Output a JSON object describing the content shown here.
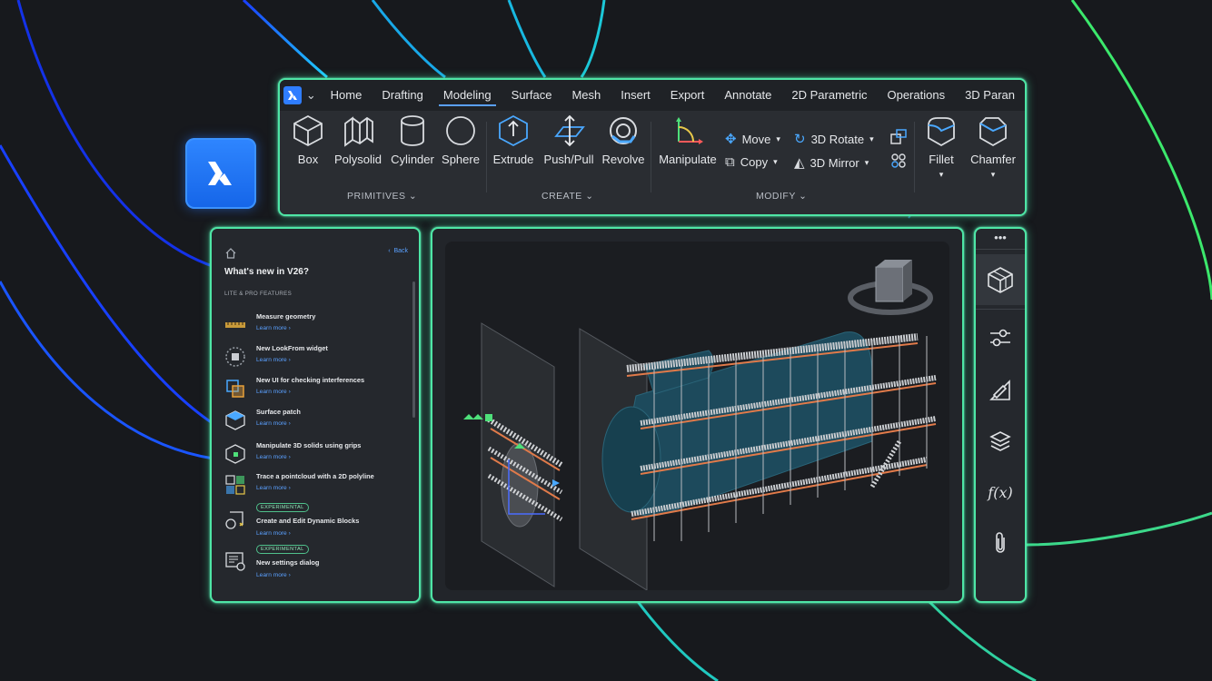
{
  "ribbon": {
    "tabs": [
      "Home",
      "Drafting",
      "Modeling",
      "Surface",
      "Mesh",
      "Insert",
      "Export",
      "Annotate",
      "2D Parametric",
      "Operations",
      "3D Paran"
    ],
    "active_tab": "Modeling",
    "primitives": {
      "group": "PRIMITIVES",
      "box": "Box",
      "polysolid": "Polysolid",
      "cylinder": "Cylinder",
      "sphere": "Sphere"
    },
    "create": {
      "group": "CREATE",
      "extrude": "Extrude",
      "pushpull": "Push/Pull",
      "revolve": "Revolve"
    },
    "modify": {
      "group": "MODIFY",
      "manipulate": "Manipulate",
      "move": "Move",
      "copy": "Copy",
      "rotate3d": "3D Rotate",
      "mirror3d": "3D Mirror"
    },
    "fillet": "Fillet",
    "chamfer": "Chamfer"
  },
  "left_panel": {
    "back": "Back",
    "title": "What's new in V26?",
    "section": "LITE & PRO FEATURES",
    "features": [
      {
        "title": "Measure geometry",
        "link": "Learn more",
        "icon": "ruler-icon"
      },
      {
        "title": "New LookFrom widget",
        "link": "Learn more",
        "icon": "lookfrom-icon"
      },
      {
        "title": "New UI for checking interferences",
        "link": "Learn more",
        "icon": "interference-icon"
      },
      {
        "title": "Surface patch",
        "link": "Learn more",
        "icon": "surface-patch-icon"
      },
      {
        "title": "Manipulate 3D solids using grips",
        "link": "Learn more",
        "icon": "grips-icon"
      },
      {
        "title": "Trace a pointcloud with a 2D polyline",
        "link": "Learn more",
        "icon": "pointcloud-icon"
      },
      {
        "title": "Create and Edit Dynamic Blocks",
        "link": "Learn more",
        "icon": "dynamic-block-icon",
        "badge": "EXPERIMENTAL"
      },
      {
        "title": "New settings dialog",
        "link": "Learn more",
        "icon": "settings-dialog-icon",
        "badge": "EXPERIMENTAL"
      }
    ]
  },
  "right_sidebar": {
    "items": [
      "3d-solid-icon",
      "sliders-icon",
      "draw-icon",
      "layers-icon",
      "function-icon",
      "paperclip-icon"
    ],
    "more": "•••"
  },
  "colors": {
    "accent": "#5aa0ff",
    "brand": "#1f6ff0",
    "glow": "#4ee6a6",
    "pipe": "#e07a4a",
    "tank": "#1d4a5c"
  }
}
